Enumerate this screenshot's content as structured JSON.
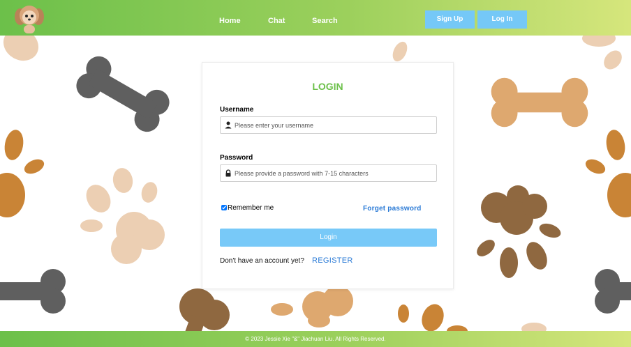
{
  "header": {
    "nav": {
      "home": "Home",
      "chat": "Chat",
      "search": "Search"
    },
    "signup_label": "Sign Up",
    "login_label": "Log In"
  },
  "login": {
    "title": "LOGIN",
    "username_label": "Username",
    "username_placeholder": "Please enter your username",
    "password_label": "Password",
    "password_placeholder": "Please provide a password with 7-15 characters",
    "remember_label": "Remember me",
    "remember_checked": true,
    "forgot_label": "Forget password",
    "submit_label": "Login",
    "no_account_text": "Don't have an account yet?",
    "register_label": "REGISTER"
  },
  "footer": {
    "copyright": "© 2023 Jessie Xie \"&\" Jiachuan Liu. All Rights Reserved."
  },
  "colors": {
    "header_green": "#6cc04a",
    "header_yellow": "#d6e67c",
    "button_blue": "#75c8f7",
    "link_blue": "#2a7ad6",
    "title_green": "#6cc04a",
    "bone_gray": "#5f5f5f",
    "bone_tan": "#dea86f",
    "paw_brown": "#8f6840",
    "paw_orange": "#c98436",
    "paw_beige": "#eccfb3"
  },
  "icons": [
    "dog-logo-icon",
    "user-icon",
    "lock-icon",
    "bone-icon",
    "paw-print-icon"
  ]
}
